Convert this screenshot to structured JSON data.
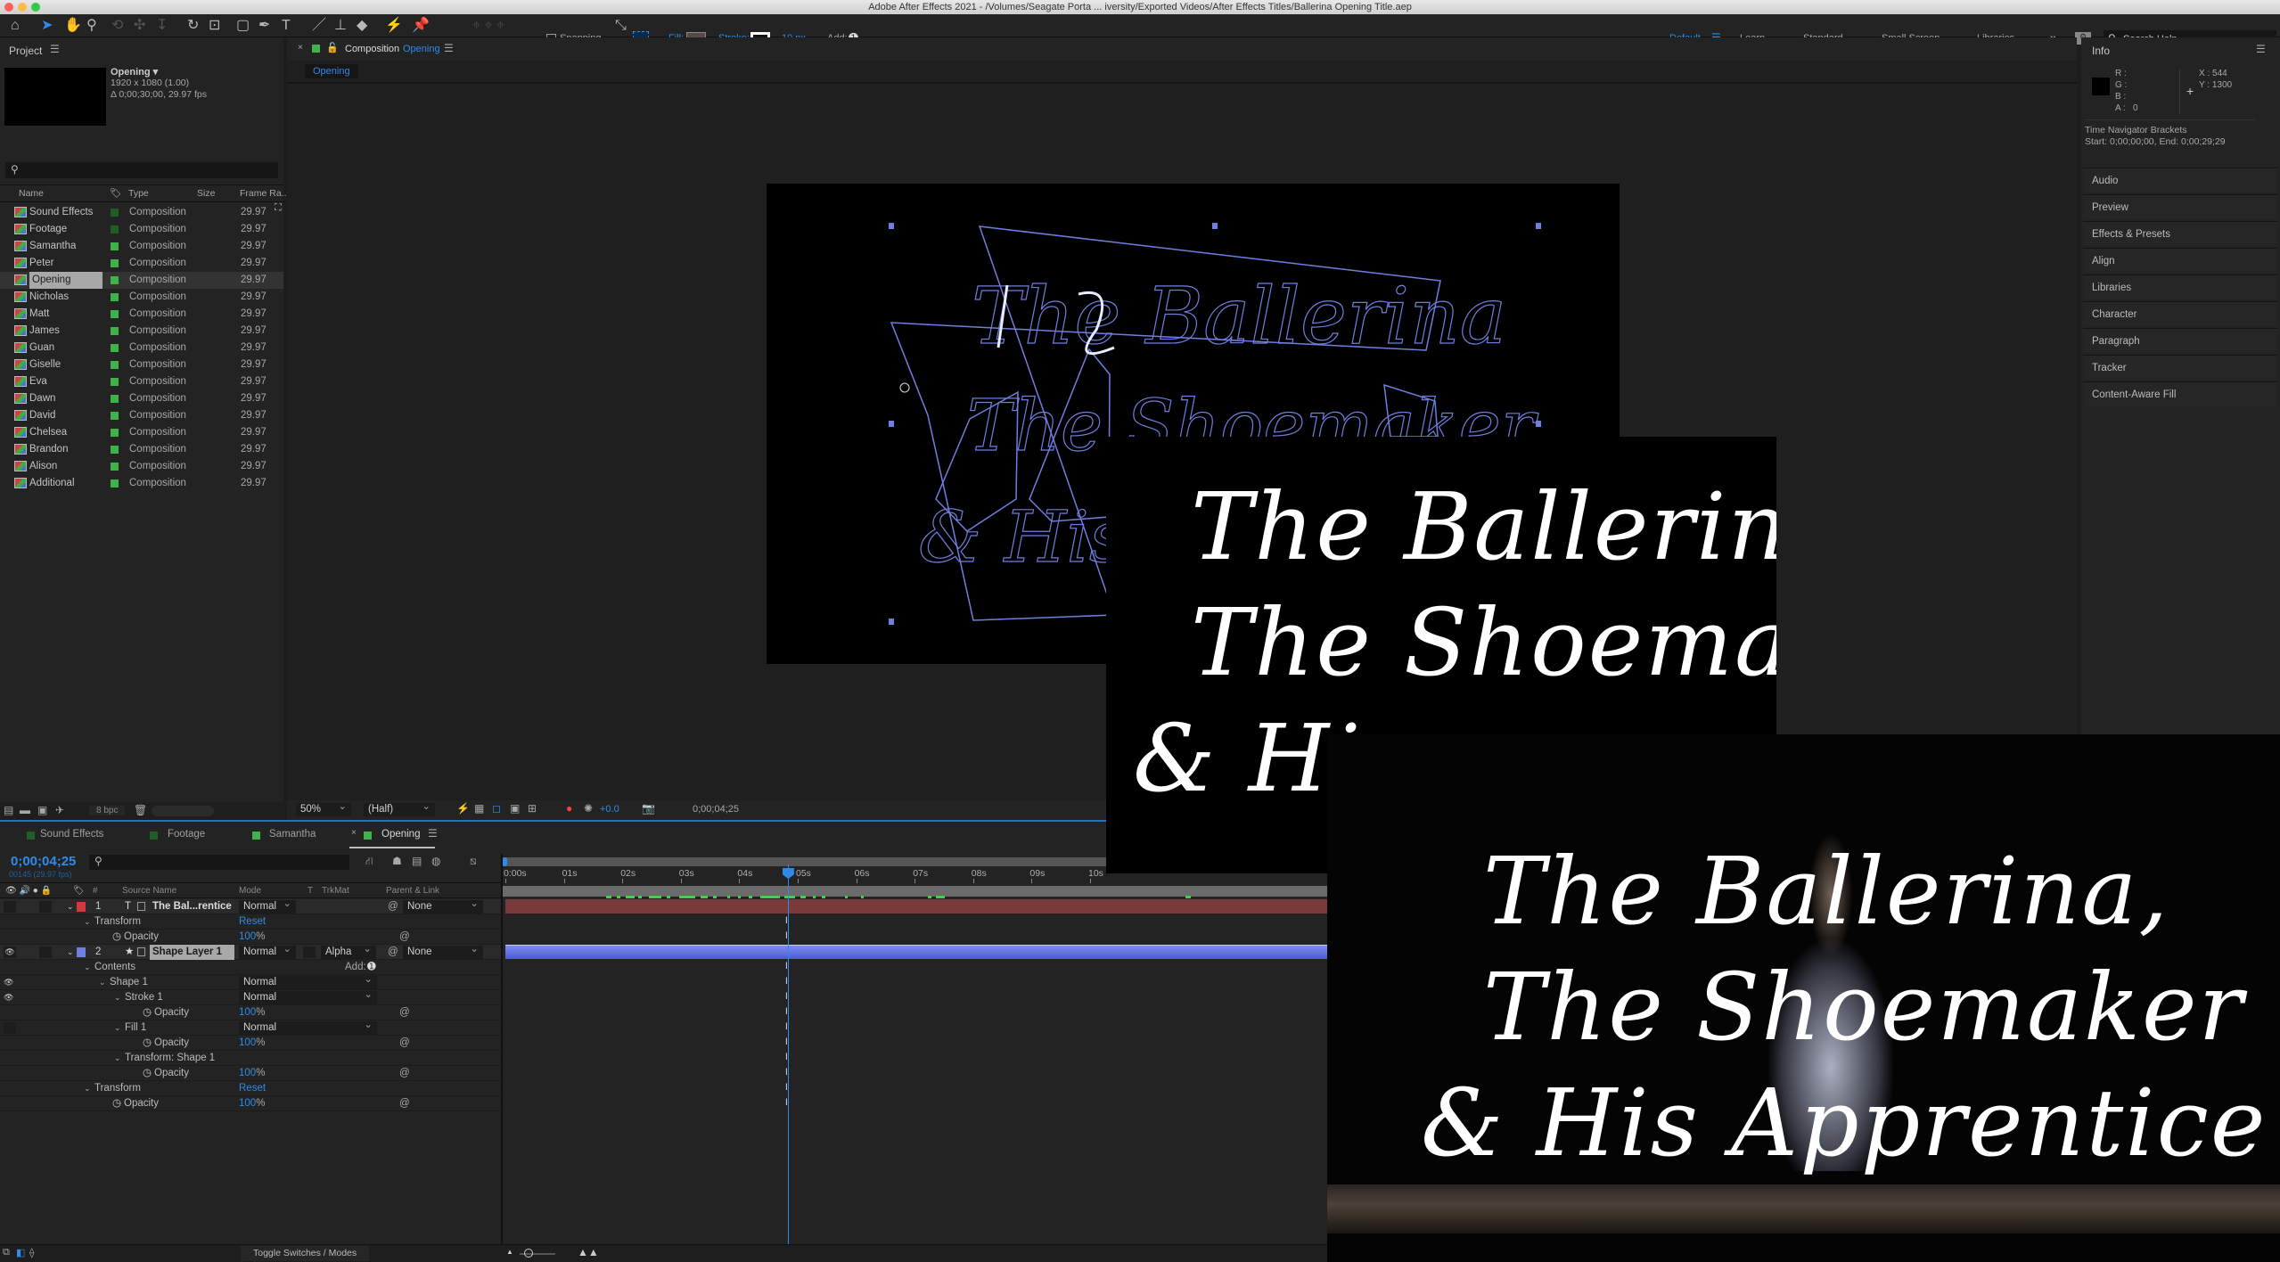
{
  "window": {
    "title": "Adobe After Effects 2021 - /Volumes/Seagate Porta ... iversity/Exported Videos/After Effects Titles/Ballerina Opening Title.aep"
  },
  "toolbar": {
    "snapping": "Snapping",
    "fill": "Fill:",
    "stroke": "Stroke:",
    "stroke_width": "10 px",
    "add": "Add:",
    "fill_color": "#5a4a46",
    "stroke_color": "#ffffff"
  },
  "workspaces": {
    "items": [
      "Default",
      "Learn",
      "Standard",
      "Small Screen",
      "Libraries"
    ],
    "active": "Default",
    "more": "»",
    "search_placeholder": "Search Help"
  },
  "project": {
    "title": "Project",
    "selected": {
      "name": "Opening ▾",
      "resolution": "1920 x 1080 (1.00)",
      "duration": "Δ 0;00;30;00, 29.97 fps"
    },
    "columns": {
      "name": "Name",
      "type": "Type",
      "size": "Size",
      "frame_rate": "Frame Ra..."
    },
    "items": [
      {
        "name": "Sound Effects",
        "type": "Composition",
        "fps": "29.97",
        "label": "#1f5f25"
      },
      {
        "name": "Footage",
        "type": "Composition",
        "fps": "29.97",
        "label": "#1f5f25"
      },
      {
        "name": "Samantha",
        "type": "Composition",
        "fps": "29.97",
        "label": "#3fb34a"
      },
      {
        "name": "Peter",
        "type": "Composition",
        "fps": "29.97",
        "label": "#3fb34a"
      },
      {
        "name": "Opening",
        "type": "Composition",
        "fps": "29.97",
        "label": "#3fb34a",
        "selected": true
      },
      {
        "name": "Nicholas",
        "type": "Composition",
        "fps": "29.97",
        "label": "#3fb34a"
      },
      {
        "name": "Matt",
        "type": "Composition",
        "fps": "29.97",
        "label": "#3fb34a"
      },
      {
        "name": "James",
        "type": "Composition",
        "fps": "29.97",
        "label": "#3fb34a"
      },
      {
        "name": "Guan",
        "type": "Composition",
        "fps": "29.97",
        "label": "#3fb34a"
      },
      {
        "name": "Giselle",
        "type": "Composition",
        "fps": "29.97",
        "label": "#3fb34a"
      },
      {
        "name": "Eva",
        "type": "Composition",
        "fps": "29.97",
        "label": "#3fb34a"
      },
      {
        "name": "Dawn",
        "type": "Composition",
        "fps": "29.97",
        "label": "#3fb34a"
      },
      {
        "name": "David",
        "type": "Composition",
        "fps": "29.97",
        "label": "#3fb34a"
      },
      {
        "name": "Chelsea",
        "type": "Composition",
        "fps": "29.97",
        "label": "#3fb34a"
      },
      {
        "name": "Brandon",
        "type": "Composition",
        "fps": "29.97",
        "label": "#3fb34a"
      },
      {
        "name": "Alison",
        "type": "Composition",
        "fps": "29.97",
        "label": "#3fb34a"
      },
      {
        "name": "Additional",
        "type": "Composition",
        "fps": "29.97",
        "label": "#3fb34a"
      }
    ],
    "bpc": "8 bpc"
  },
  "composition": {
    "tab_prefix": "Composition",
    "tab_name": "Opening",
    "subtab": "Opening",
    "zoom": "50%",
    "resolution": "(Half)",
    "exposure": "+0.0",
    "timecode": "0;00;04;25"
  },
  "frames": {
    "line1": "The Ballerina,",
    "line2": "The Shoemaker",
    "line3": "& His Apprentice",
    "line3_partial": "& His"
  },
  "info": {
    "title": "Info",
    "r": "R :",
    "g": "G :",
    "b": "B :",
    "a": "A :",
    "a_value": "0",
    "x": "X : 544",
    "y": "Y : 1300",
    "nav_title": "Time Navigator Brackets",
    "nav_range": "Start: 0;00;00;00, End: 0;00;29;29"
  },
  "side_panels": [
    "Audio",
    "Preview",
    "Effects & Presets",
    "Align",
    "Libraries",
    "Character",
    "Paragraph",
    "Tracker",
    "Content-Aware Fill"
  ],
  "timeline": {
    "tabs": [
      {
        "name": "Sound Effects",
        "label": "#1f5f25"
      },
      {
        "name": "Footage",
        "label": "#1f5f25"
      },
      {
        "name": "Samantha",
        "label": "#3fb34a"
      },
      {
        "name": "Opening",
        "label": "#3fb34a",
        "active": true
      }
    ],
    "timecode": "0;00;04;25",
    "frame": "00145 (29.97 fps)",
    "columns": {
      "num": "#",
      "source": "Source Name",
      "mode": "Mode",
      "t": "T",
      "trkmat": "TrkMat",
      "parent": "Parent & Link"
    },
    "ruler": [
      "0:00s",
      "01s",
      "02s",
      "03s",
      "04s",
      "05s",
      "06s",
      "07s",
      "08s",
      "09s",
      "10s"
    ],
    "current_time_s": 4.83,
    "rows": [
      {
        "kind": "layer",
        "num": "1",
        "name": "The Bal...rentice",
        "mode": "Normal",
        "parent": "None",
        "color": "#d03a3a",
        "icon": "T"
      },
      {
        "kind": "group",
        "level": 1,
        "label": "Transform",
        "value": "Reset"
      },
      {
        "kind": "prop",
        "level": 1,
        "label": "Opacity",
        "value": "100",
        "unit": "%"
      },
      {
        "kind": "layer",
        "num": "2",
        "name": "Shape Layer 1",
        "mode": "Normal",
        "trkmat": "Alpha",
        "parent": "None",
        "color": "#6f7fe0",
        "icon": "★",
        "selected": true
      },
      {
        "kind": "group",
        "level": 1,
        "label": "Contents",
        "add": "Add:"
      },
      {
        "kind": "group",
        "level": 2,
        "label": "Shape 1",
        "mode": "Normal",
        "eye": true
      },
      {
        "kind": "group",
        "level": 3,
        "label": "Stroke 1",
        "mode": "Normal",
        "eye": true
      },
      {
        "kind": "prop",
        "level": 3,
        "label": "Opacity",
        "value": "100",
        "unit": "%"
      },
      {
        "kind": "group",
        "level": 3,
        "label": "Fill 1",
        "mode": "Normal"
      },
      {
        "kind": "prop",
        "level": 3,
        "label": "Opacity",
        "value": "100",
        "unit": "%"
      },
      {
        "kind": "group",
        "level": 3,
        "label": "Transform: Shape 1"
      },
      {
        "kind": "prop",
        "level": 3,
        "label": "Opacity",
        "value": "100",
        "unit": "%"
      },
      {
        "kind": "group",
        "level": 1,
        "label": "Transform",
        "value": "Reset"
      },
      {
        "kind": "prop",
        "level": 1,
        "label": "Opacity",
        "value": "100",
        "unit": "%"
      }
    ],
    "toggle": "Toggle Switches / Modes"
  }
}
